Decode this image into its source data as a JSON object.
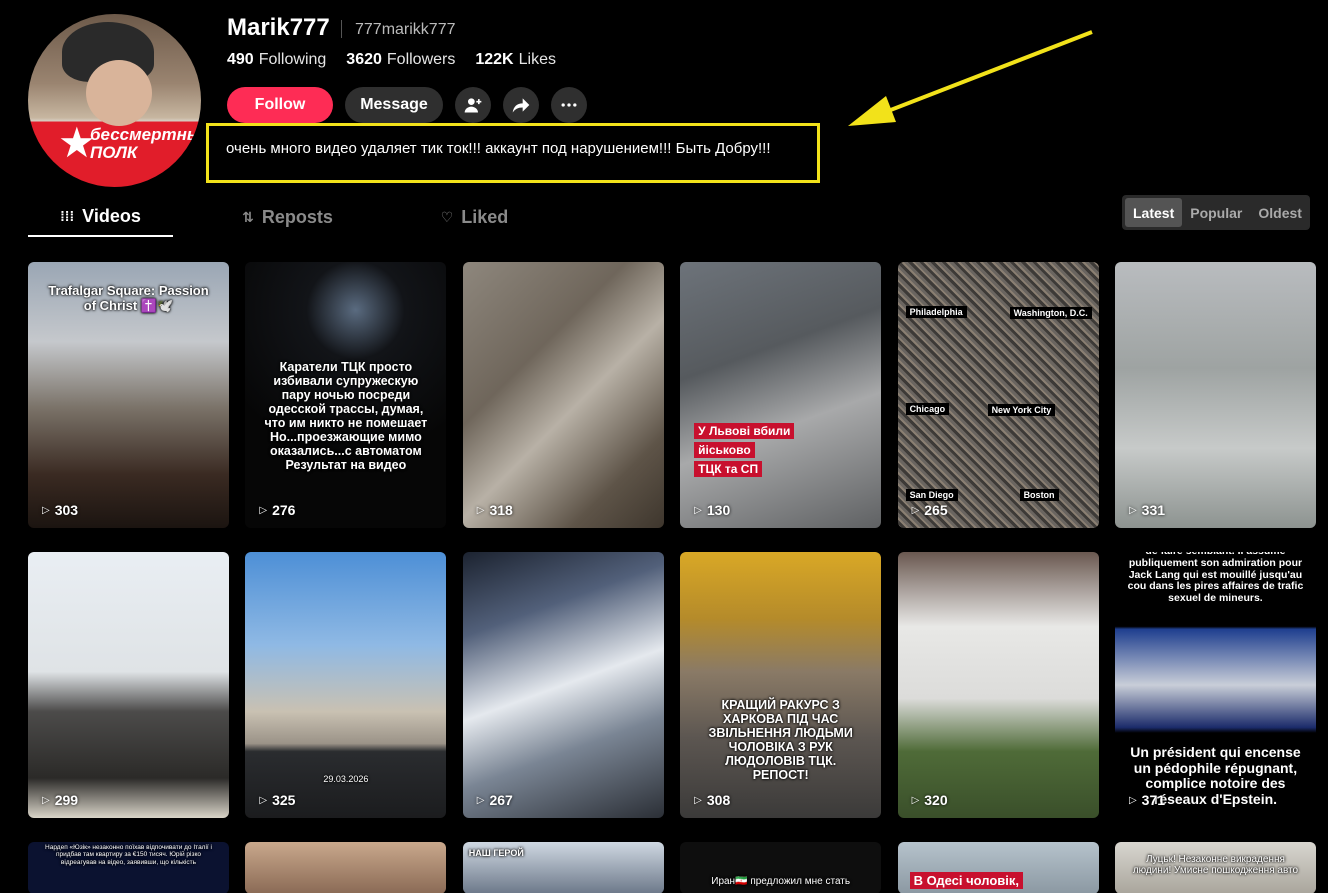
{
  "profile": {
    "username": "Marik777",
    "handle": "777marikk777",
    "following_count": "490",
    "following_label": "Following",
    "followers_count": "3620",
    "followers_label": "Followers",
    "likes_count": "122K",
    "likes_label": "Likes",
    "avatar_badge_line1": "бессмертный",
    "avatar_badge_line2": "ПОЛК",
    "bio": "очень много видео удаляет тик ток!!! аккаунт под нарушением!!! Быть Добру!!!"
  },
  "actions": {
    "follow_label": "Follow",
    "message_label": "Message"
  },
  "tabs": [
    {
      "label": "Videos"
    },
    {
      "label": "Reposts"
    },
    {
      "label": "Liked"
    }
  ],
  "sort": [
    {
      "label": "Latest"
    },
    {
      "label": "Popular"
    },
    {
      "label": "Oldest"
    }
  ],
  "videos": [
    {
      "views": "303",
      "caption": "Trafalgar Square: Passion of Christ ✝️🕊️"
    },
    {
      "views": "276",
      "caption": "Каратели ТЦК просто избивали супружескую пару ночью посреди одесской трассы, думая, что им никто не помешает Но...проезжающие мимо оказались...с автоматом Результат на видео"
    },
    {
      "views": "318",
      "caption": ""
    },
    {
      "views": "130",
      "caption_l1": "У Львові вбили",
      "caption_l2": "йіськово",
      "caption_l3": "ТЦК та СП"
    },
    {
      "views": "265",
      "city1": "Philadelphia",
      "city2": "Washington, D.C.",
      "city3": "Chicago",
      "city4": "New York City",
      "city5": "San Diego",
      "city6": "Boston"
    },
    {
      "views": "331",
      "caption": ""
    },
    {
      "views": "299",
      "caption": ""
    },
    {
      "views": "325",
      "caption": "29.03.2026"
    },
    {
      "views": "267",
      "caption": ""
    },
    {
      "views": "308",
      "caption": "КРАЩИЙ РАКУРС З ХАРКОВА ПІД ЧАС ЗВІЛЬНЕННЯ ЛЮДЬМИ ЧОЛОВІКА З РУК ЛЮДОЛОВІВ ТЦК. РЕПОСТ!"
    },
    {
      "views": "320",
      "caption": ""
    },
    {
      "views": "371",
      "caption_top": "de faire semblant. Il assume publiquement son admiration pour Jack Lang qui est mouillé jusqu'au cou dans les pires affaires de trafic sexuel de mineurs.",
      "caption_bottom": "Un président qui encense un pédophile répugnant, complice notoire des réseaux d'Epstein."
    },
    {
      "caption": "Нардеп «Юзік» незаконно поїхав відпочивати до Італії і придбав там квартиру за €150 тисяч. Юрій різко відреагував на відео, заявивши, що кількість"
    },
    {
      "caption": ""
    },
    {
      "caption": "НАШ ГЕРОЙ"
    },
    {
      "caption": "Иран🇮🇷 предложил мне стать"
    },
    {
      "caption": "В Одесі чоловік,"
    },
    {
      "caption": "Луцьк! Незаконне викрадення людини! Умисне пошкодження авто"
    }
  ]
}
